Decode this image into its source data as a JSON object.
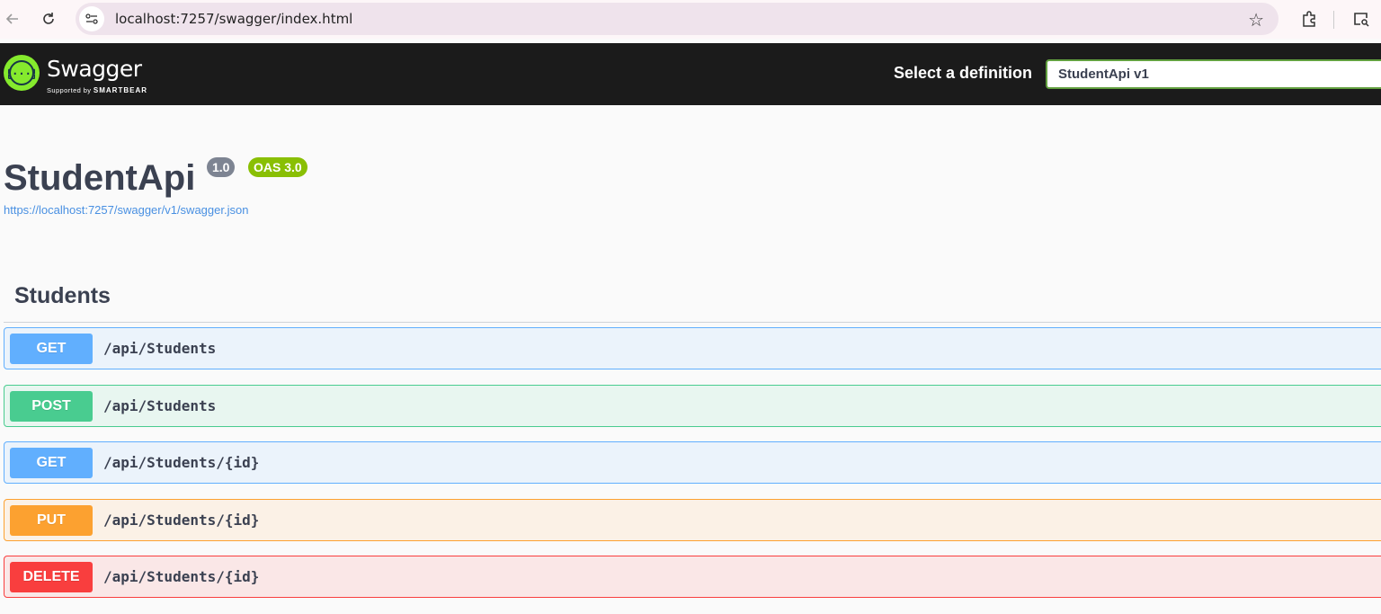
{
  "browser": {
    "url": "localhost:7257/swagger/index.html",
    "icons": [
      "back-arrow-icon",
      "reload-icon",
      "site-settings-icon",
      "bookmark-star-icon",
      "extensions-icon",
      "tab-search-icon"
    ]
  },
  "topbar": {
    "brand": "Swagger",
    "brand_sub_prefix": "Supported by",
    "brand_sub_company": "SMARTBEAR",
    "definition_label": "Select a definition",
    "definition_selected": "StudentApi v1",
    "accent_color": "#85ea2d"
  },
  "info": {
    "title": "StudentApi",
    "version": "1.0",
    "oas_version": "OAS 3.0",
    "spec_url": "https://localhost:7257/swagger/v1/swagger.json"
  },
  "tag": {
    "name": "Students"
  },
  "operations": [
    {
      "method": "GET",
      "path": "/api/Students",
      "color": "#61affe"
    },
    {
      "method": "POST",
      "path": "/api/Students",
      "color": "#49cc90"
    },
    {
      "method": "GET",
      "path": "/api/Students/{id}",
      "color": "#61affe"
    },
    {
      "method": "PUT",
      "path": "/api/Students/{id}",
      "color": "#fca130"
    },
    {
      "method": "DELETE",
      "path": "/api/Students/{id}",
      "color": "#f93e3e"
    }
  ]
}
